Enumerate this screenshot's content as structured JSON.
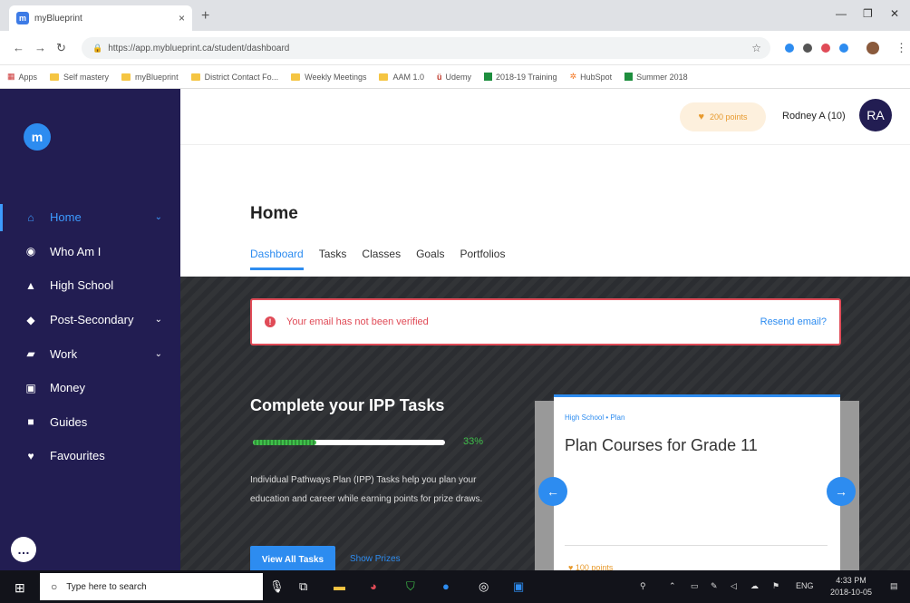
{
  "browser": {
    "tab_title": "myBlueprint",
    "tab_close": "×",
    "new_tab": "+",
    "url": "https://app.myblueprint.ca/student/dashboard",
    "bookmarks": [
      "Apps",
      "Self mastery",
      "myBlueprint",
      "District Contact Fo...",
      "Weekly Meetings",
      "AAM 1.0",
      "Udemy",
      "2018-19 Training",
      "HubSpot",
      "Summer 2018"
    ]
  },
  "sidebar": {
    "logo": "m",
    "items": [
      {
        "label": "Home",
        "icon": "home-icon",
        "active": true,
        "chevron": "⌄"
      },
      {
        "label": "Who Am I",
        "icon": "compass-icon"
      },
      {
        "label": "High School",
        "icon": "school-icon"
      },
      {
        "label": "Post-Secondary",
        "icon": "graduation-cap-icon",
        "chevron": "⌄"
      },
      {
        "label": "Work",
        "icon": "briefcase-icon",
        "chevron": "⌄"
      },
      {
        "label": "Money",
        "icon": "money-icon"
      },
      {
        "label": "Guides",
        "icon": "book-icon"
      },
      {
        "label": "Favourites",
        "icon": "heart-icon"
      }
    ]
  },
  "header": {
    "points": "200 points",
    "user_name": "Rodney A (10)",
    "avatar_initials": "RA"
  },
  "home": {
    "title": "Home",
    "tabs": [
      "Dashboard",
      "Tasks",
      "Classes",
      "Goals",
      "Portfolios"
    ]
  },
  "alert": {
    "message": "Your email has not been verified",
    "action": "Resend email?"
  },
  "ipp": {
    "title": "Complete your IPP Tasks",
    "progress_percent": 33,
    "progress_label": "33%",
    "description": "Individual Pathways Plan (IPP) Tasks help you plan your education and career while earning points for prize draws.",
    "view_all": "View All Tasks",
    "show_prizes": "Show Prizes"
  },
  "card": {
    "crumb": "High School • Plan",
    "title": "Plan Courses for Grade 11",
    "points": "100 points"
  },
  "taskbar": {
    "search_placeholder": "Type here to search",
    "lang": "ENG",
    "time": "4:33 PM",
    "date": "2018-10-05"
  },
  "colors": {
    "sidebar": "#221d52",
    "accent": "#2d8cf0",
    "error": "#e04b57",
    "success": "#3fbf4a",
    "points": "#e79a2e"
  }
}
